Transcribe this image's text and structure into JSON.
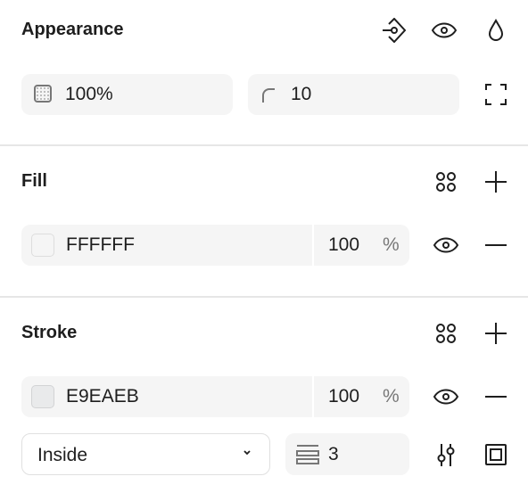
{
  "appearance": {
    "title": "Appearance",
    "opacity": "100%",
    "corner_radius": "10",
    "icons": [
      "variable-binding-icon",
      "eye-icon",
      "blend-drop-icon",
      "independent-corners-icon"
    ]
  },
  "fill": {
    "title": "Fill",
    "hex": "FFFFFF",
    "opacity": "100",
    "percent": "%",
    "swatch_color": "#FFFFFF"
  },
  "stroke": {
    "title": "Stroke",
    "hex": "E9EAEB",
    "opacity": "100",
    "percent": "%",
    "swatch_color": "#E9EAEB",
    "position": "Inside",
    "weight": "3"
  }
}
